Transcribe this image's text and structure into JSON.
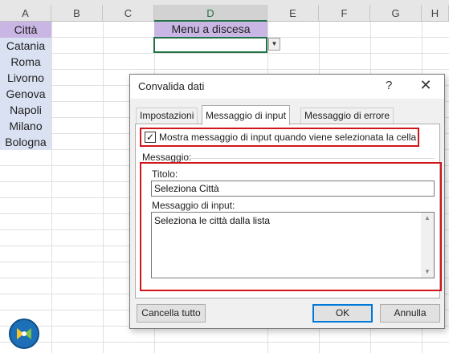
{
  "sheet": {
    "columns": [
      "A",
      "B",
      "C",
      "D",
      "E",
      "F",
      "G",
      "H"
    ],
    "col_a": [
      "Città",
      "Catania",
      "Roma",
      "Livorno",
      "Genova",
      "Napoli",
      "Milano",
      "Bologna"
    ],
    "d_header": "Menu a discesa",
    "dropdown_arrow": "▼"
  },
  "dialog": {
    "title": "Convalida dati",
    "help": "?",
    "close": "✕",
    "tabs": [
      "Impostazioni",
      "Messaggio di input",
      "Messaggio di errore"
    ],
    "checkbox_mark": "✓",
    "checkbox_label": "Mostra messaggio di input quando viene selezionata la cella",
    "group_label": "Messaggio:",
    "title_field_label": "Titolo:",
    "title_field_value": "Seleziona Città",
    "message_field_label": "Messaggio di input:",
    "message_field_value": "Seleziona le città dalla lista",
    "buttons": {
      "clear_all": "Cancella tutto",
      "ok": "OK",
      "cancel": "Annulla"
    }
  },
  "colors": {
    "accent_green": "#217346",
    "purple_header": "#c9b6e4",
    "blue_cells": "#d9e1f2",
    "highlight_red": "#d0161b",
    "focus_blue": "#0078d7"
  }
}
